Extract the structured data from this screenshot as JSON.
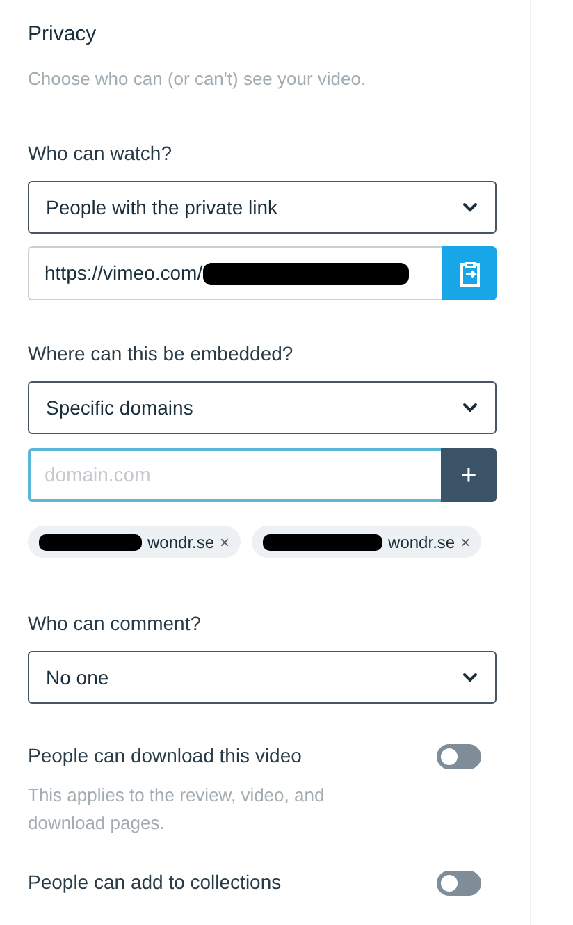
{
  "title": "Privacy",
  "subtitle": "Choose who can (or can't) see your video.",
  "watch": {
    "label": "Who can watch?",
    "value": "People with the private link",
    "link": "https://vimeo.com/"
  },
  "embed": {
    "label": "Where can this be embedded?",
    "value": "Specific domains",
    "placeholder": "domain.com",
    "add_button": "+",
    "domains": [
      {
        "text": "wondr.se",
        "remove": "×"
      },
      {
        "text": "wondr.se",
        "remove": "×"
      }
    ]
  },
  "comment": {
    "label": "Who can comment?",
    "value": "No one"
  },
  "toggles": [
    {
      "label": "People can download this video",
      "on": false,
      "help": "This applies to the review, video, and download pages."
    },
    {
      "label": "People can add to collections",
      "on": false
    }
  ]
}
